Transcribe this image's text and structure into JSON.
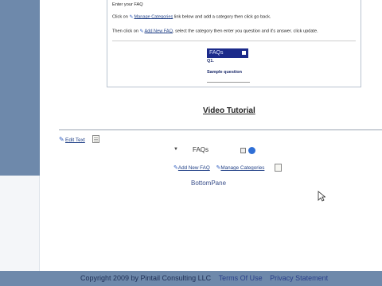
{
  "instructions": {
    "enter_faq": "Enter your FAQ",
    "step1_pre": "Click on",
    "step1_link": "Manage Categories",
    "step1_post": "link below and add a category then click go back.",
    "step2_pre": "Then click on",
    "step2_link": "Add New FAQ",
    "step2_post": ", select the category then enter you question and it's answer. click update."
  },
  "preview": {
    "faq_header": "FAQs",
    "q_label": "Q1.",
    "sample_question": "Sample question"
  },
  "video": {
    "title": "Video Tutorial"
  },
  "module": {
    "edit_text": "Edit Text",
    "faqs_label": "FAQs",
    "add_new_faq": "Add New FAQ",
    "manage_categories": "Manage Categories"
  },
  "bottom_pane": {
    "label": "BottomPane"
  },
  "footer": {
    "copyright": "Copyright 2009 by Pintail Consulting LLC",
    "terms": "Terms Of Use",
    "privacy": "Privacy Statement"
  },
  "colors": {
    "sidebar": "#6e89ab",
    "link": "#1f3f86",
    "faq_header_bg": "#1b2a8a"
  }
}
